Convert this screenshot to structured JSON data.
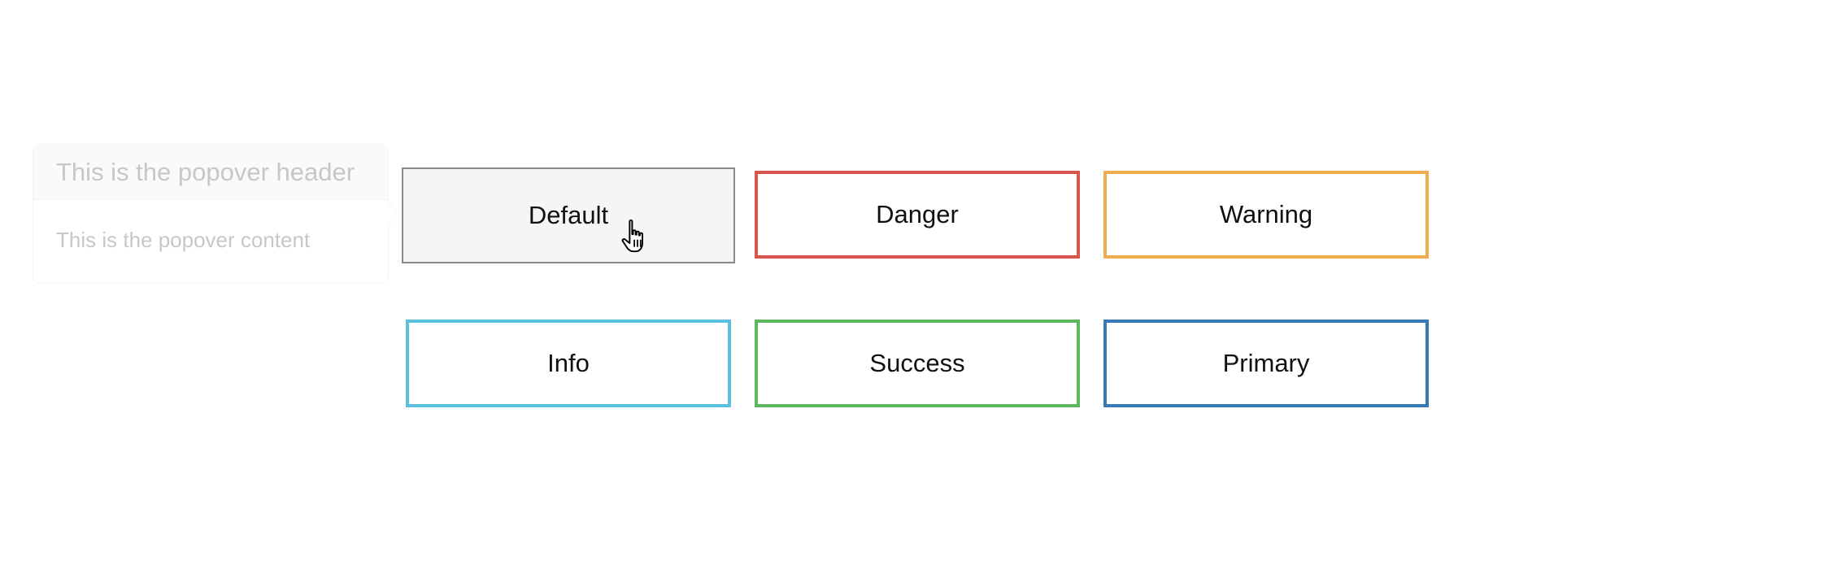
{
  "popover": {
    "header": "This is the popover header",
    "content": "This is the popover content"
  },
  "buttons": {
    "default": "Default",
    "danger": "Danger",
    "warning": "Warning",
    "info": "Info",
    "success": "Success",
    "primary": "Primary"
  },
  "colors": {
    "danger": "#d9534f",
    "warning": "#f0ad4e",
    "info": "#5bc0de",
    "success": "#5cb85c",
    "primary": "#337ab7",
    "default": "#8a8a8a"
  },
  "cursor": {
    "icon": "hand-pointer-icon"
  }
}
